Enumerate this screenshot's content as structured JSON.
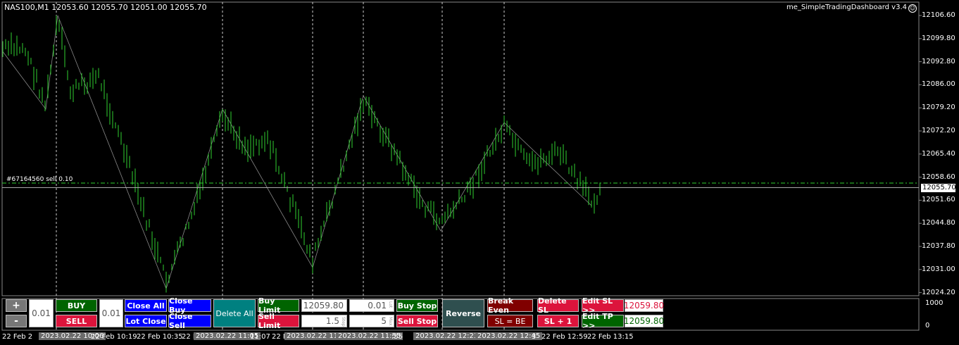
{
  "header": {
    "symbol_info": "NAS100,M1  12053.60 12055.70 12051.00 12055.70",
    "ea_name": "me_SimpleTradingDashboard v3.4",
    "order_label": "#67164560 sell 0.10"
  },
  "price_axis": {
    "labels": [
      "12106.60",
      "12099.80",
      "12092.80",
      "12086.00",
      "12079.20",
      "12072.20",
      "12065.40",
      "12058.60",
      "12051.60",
      "12044.80",
      "12037.80",
      "12031.00",
      "12024.20"
    ],
    "current_price": "12055.70"
  },
  "volume_axis": {
    "labels": [
      "1000",
      "0"
    ]
  },
  "time_axis": {
    "labels": [
      "22 Feb 2",
      "22 Feb 10:19",
      "22 Feb 10:35",
      "22 F",
      "11:07",
      "22 F",
      "22 Feb 12:59",
      "22 Feb 13:15",
      ":55",
      "3"
    ],
    "highlighted": [
      "2023.02.22 10:06",
      "2023.02.22 11:05",
      "2023.02.22 11:3",
      "2023.02.22 11:55",
      "2023.02.22 12:23",
      "2023.02.22 12:45"
    ]
  },
  "dashboard": {
    "lot_plus": "+",
    "lot_minus": "-",
    "lot_value_1": "0.01",
    "buy": "BUY",
    "sell": "SELL",
    "lot_value_2": "0.01",
    "close_all": "Close All",
    "close_buy": "Close Buy",
    "lot_close": "Lot Close",
    "close_sell": "Close Sell",
    "delete_all": "Delete All",
    "buy_limit": "Buy Limit",
    "sell_limit": "Sell Limit",
    "pending_price": "12059.80",
    "pending_lot": "0.01",
    "pending_step": "1.5",
    "pending_max": "5",
    "pending_lot_sub": "Lot",
    "pending_step_sub": "Step",
    "pending_max_sub": "Max",
    "buy_stop": "Buy Stop",
    "sell_stop": "Sell Stop",
    "reverse": "Reverse",
    "break_even": "Break Even",
    "sl_be": "SL = BE",
    "delete_sl": "Delete SL",
    "sl_plus_one": "SL + 1",
    "edit_sl": "Edit SL >>",
    "edit_tp": "Edit TP >>",
    "sl_value": "12059.80",
    "tp_value": "12059.80"
  },
  "colors": {
    "candle": "#2fd02f",
    "buy": "#006400",
    "sell": "#dc143c",
    "blue_btn": "#0000ff",
    "teal_btn": "#008080",
    "dark_btn": "#2f4f4f",
    "maroon_btn": "#800000",
    "red_btn": "#dc143c"
  }
}
